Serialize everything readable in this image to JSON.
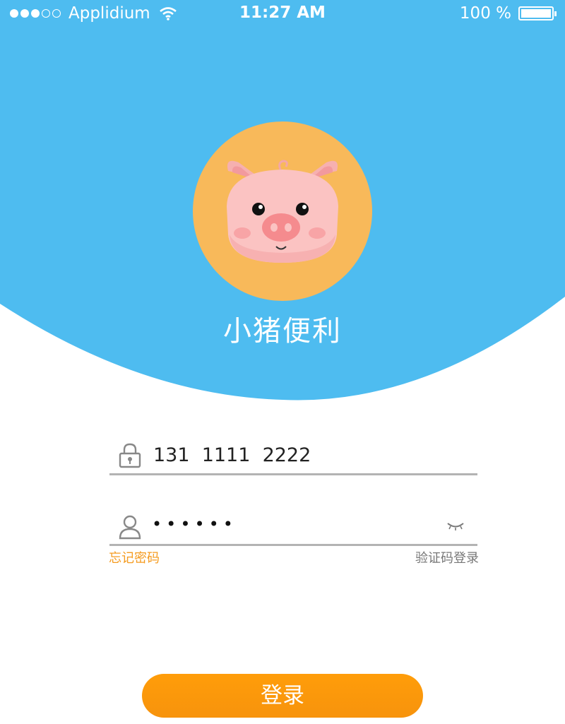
{
  "status_bar": {
    "carrier": "Applidium",
    "time": "11:27 AM",
    "battery": "100 %"
  },
  "app": {
    "title": "小猪便利"
  },
  "form": {
    "phone_value": "131  1111  2222",
    "password_masked": "••••••",
    "forgot_password": "忘记密码",
    "sms_login": "验证码登录",
    "login_button": "登录"
  },
  "icons": {
    "field1": "lock-icon",
    "field2": "user-icon",
    "toggle": "eye-closed-icon",
    "logo": "pig-face-logo"
  },
  "colors": {
    "header_blue": "#4ebcf0",
    "logo_circle": "#f8b95a",
    "accent_orange": "#f59b1f",
    "button_orange": "#ff9d0a",
    "underline_gray": "#b3b3b3"
  }
}
